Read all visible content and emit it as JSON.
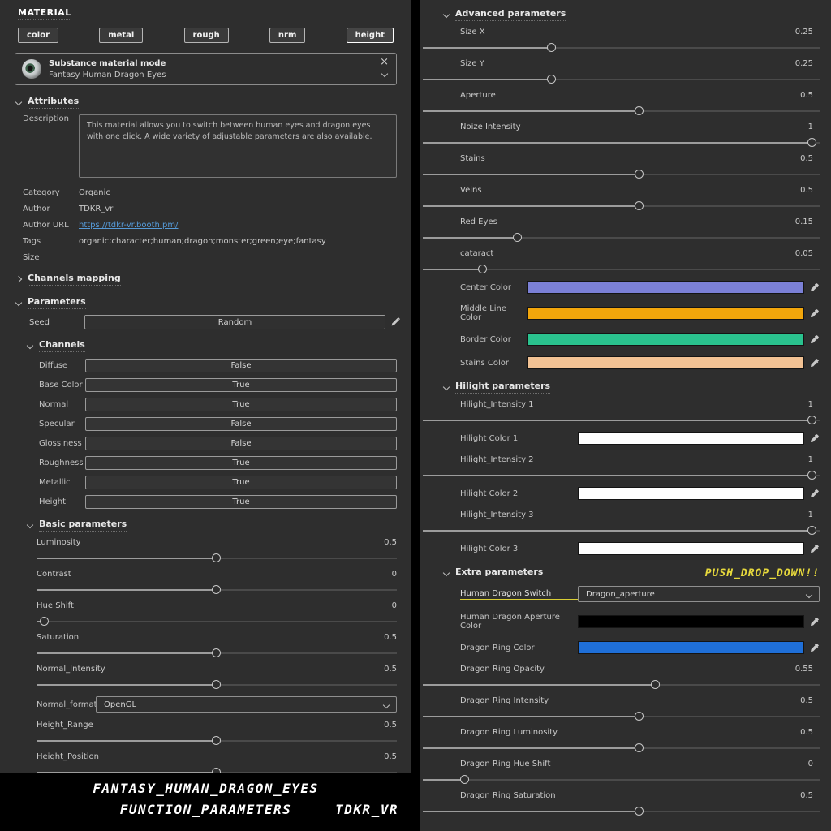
{
  "icons": {
    "close": "×"
  },
  "left": {
    "header": "MATERIAL",
    "preset_buttons": [
      {
        "label": "color",
        "active": false
      },
      {
        "label": "metal",
        "active": false
      },
      {
        "label": "rough",
        "active": false
      },
      {
        "label": "nrm",
        "active": false
      },
      {
        "label": "height",
        "active": true
      }
    ],
    "material_selector": {
      "title": "Substance material mode",
      "value": "Fantasy Human Dragon Eyes"
    },
    "attributes": {
      "title": "Attributes",
      "description_label": "Description",
      "description": "This material allows you to switch between human eyes and dragon eyes with one click. A wide variety of adjustable parameters are also available.",
      "fields": [
        {
          "label": "Category",
          "value": "Organic",
          "type": "text"
        },
        {
          "label": "Author",
          "value": "TDKR_vr",
          "type": "text"
        },
        {
          "label": "Author URL",
          "value": "https://tdkr-vr.booth.pm/",
          "type": "link"
        },
        {
          "label": "Tags",
          "value": "organic;character;human;dragon;monster;green;eye;fantasy",
          "type": "text"
        },
        {
          "label": "Size",
          "value": "",
          "type": "text"
        }
      ]
    },
    "channels_mapping_title": "Channels mapping",
    "parameters": {
      "title": "Parameters",
      "seed": {
        "label": "Seed",
        "value": "Random"
      },
      "channels": {
        "title": "Channels",
        "toggles": [
          {
            "label": "Diffuse",
            "value": "False"
          },
          {
            "label": "Base Color",
            "value": "True"
          },
          {
            "label": "Normal",
            "value": "True"
          },
          {
            "label": "Specular",
            "value": "False"
          },
          {
            "label": "Glossiness",
            "value": "False"
          },
          {
            "label": "Roughness",
            "value": "True"
          },
          {
            "label": "Metallic",
            "value": "True"
          },
          {
            "label": "Height",
            "value": "True"
          }
        ]
      },
      "basic": {
        "title": "Basic parameters",
        "rows": [
          {
            "type": "slider",
            "label": "Luminosity",
            "value": "0.5",
            "pos": 0.5
          },
          {
            "type": "slider",
            "label": "Contrast",
            "value": "0",
            "pos": 0.5
          },
          {
            "type": "slider",
            "label": "Hue Shift",
            "value": "0",
            "pos": 0.022
          },
          {
            "type": "slider",
            "label": "Saturation",
            "value": "0.5",
            "pos": 0.5
          },
          {
            "type": "slider",
            "label": "Normal_Intensity",
            "value": "0.5",
            "pos": 0.5
          },
          {
            "type": "select",
            "label": "Normal_format",
            "value": "OpenGL"
          },
          {
            "type": "slider",
            "label": "Height_Range",
            "value": "0.5",
            "pos": 0.5
          },
          {
            "type": "slider",
            "label": "Height_Position",
            "value": "0.5",
            "pos": 0.5
          }
        ]
      }
    },
    "footer": {
      "line1": "FANTASY_HUMAN_DRAGON_EYES",
      "line2": "FUNCTION_PARAMETERS",
      "credit": "TDKR_VR"
    }
  },
  "right": {
    "advanced": {
      "title": "Advanced parameters",
      "rows": [
        {
          "type": "slider",
          "label": "Size X",
          "value": "0.25",
          "pos": 0.325
        },
        {
          "type": "slider",
          "label": "Size Y",
          "value": "0.25",
          "pos": 0.325
        },
        {
          "type": "slider",
          "label": "Aperture",
          "value": "0.5",
          "pos": 0.546
        },
        {
          "type": "slider",
          "label": "Noize Intensity",
          "value": "1",
          "pos": 0.982
        },
        {
          "type": "slider",
          "label": "Stains",
          "value": "0.5",
          "pos": 0.546
        },
        {
          "type": "slider",
          "label": "Veins",
          "value": "0.5",
          "pos": 0.546
        },
        {
          "type": "slider",
          "label": "Red Eyes",
          "value": "0.15",
          "pos": 0.24
        },
        {
          "type": "slider",
          "label": "cataract",
          "value": "0.05",
          "pos": 0.151
        },
        {
          "type": "color",
          "label": "Center Color",
          "color": "#7b80d6"
        },
        {
          "type": "color",
          "label": "Middle Line Color",
          "color": "#f2a60b"
        },
        {
          "type": "color",
          "label": "Border Color",
          "color": "#2ac28e"
        },
        {
          "type": "color",
          "label": "Stains Color",
          "color": "#f2c294"
        }
      ]
    },
    "hilight": {
      "title": "Hilight parameters",
      "rows": [
        {
          "type": "slider",
          "label": "Hilight_Intensity 1",
          "value": "1",
          "pos": 0.982
        },
        {
          "type": "color",
          "label": "Hilight Color 1",
          "color": "#ffffff"
        },
        {
          "type": "slider",
          "label": "Hilight_Intensity 2",
          "value": "1",
          "pos": 0.982
        },
        {
          "type": "color",
          "label": "Hilight Color 2",
          "color": "#ffffff"
        },
        {
          "type": "slider",
          "label": "Hilight_Intensity 3",
          "value": "1",
          "pos": 0.982
        },
        {
          "type": "color",
          "label": "Hilight Color 3",
          "color": "#ffffff"
        }
      ]
    },
    "extra": {
      "title": "Extra parameters",
      "push_note": "PUSH_DROP_DOWN!!",
      "rows": [
        {
          "type": "select",
          "label": "Human Dragon Switch",
          "value": "Dragon_aperture",
          "highlight": true
        },
        {
          "type": "color",
          "label": "Human Dragon Aperture Color",
          "color": "#000000"
        },
        {
          "type": "color",
          "label": "Dragon Ring Color",
          "color": "#1f6fd8"
        },
        {
          "type": "slider",
          "label": "Dragon Ring Opacity",
          "value": "0.55",
          "pos": 0.587
        },
        {
          "type": "slider",
          "label": "Dragon Ring Intensity",
          "value": "0.5",
          "pos": 0.546
        },
        {
          "type": "slider",
          "label": "Dragon Ring Luminosity",
          "value": "0.5",
          "pos": 0.546
        },
        {
          "type": "slider",
          "label": "Dragon Ring Hue Shift",
          "value": "0",
          "pos": 0.106
        },
        {
          "type": "slider",
          "label": "Dragon Ring Saturation",
          "value": "0.5",
          "pos": 0.546
        }
      ]
    }
  }
}
